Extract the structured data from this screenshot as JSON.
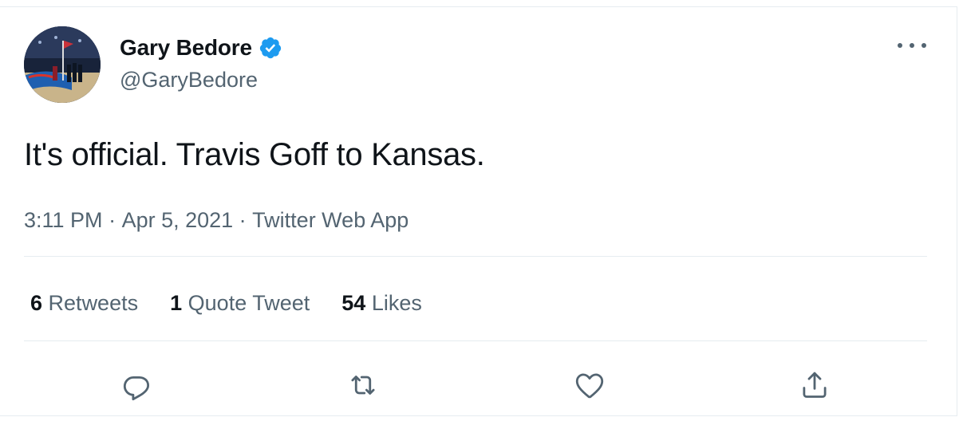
{
  "user": {
    "name": "Gary Bedore",
    "handle": "@GaryBedore",
    "verified": true
  },
  "tweet": {
    "text": "It's official. Travis Goff to Kansas.",
    "time": "3:11 PM",
    "date": "Apr 5, 2021",
    "source": "Twitter Web App",
    "separator": " · "
  },
  "stats": {
    "retweets_count": "6",
    "retweets_label": "Retweets",
    "quotes_count": "1",
    "quotes_label": "Quote Tweet",
    "likes_count": "54",
    "likes_label": "Likes"
  },
  "icons": {
    "reply": "reply-icon",
    "retweet": "retweet-icon",
    "like": "heart-icon",
    "share": "share-icon",
    "more": "more-icon",
    "verified": "verified-badge-icon"
  },
  "colors": {
    "primary_text": "#0f1419",
    "secondary_text": "#536471",
    "verified_blue": "#1d9bf0",
    "divider": "#e6ecf0"
  }
}
